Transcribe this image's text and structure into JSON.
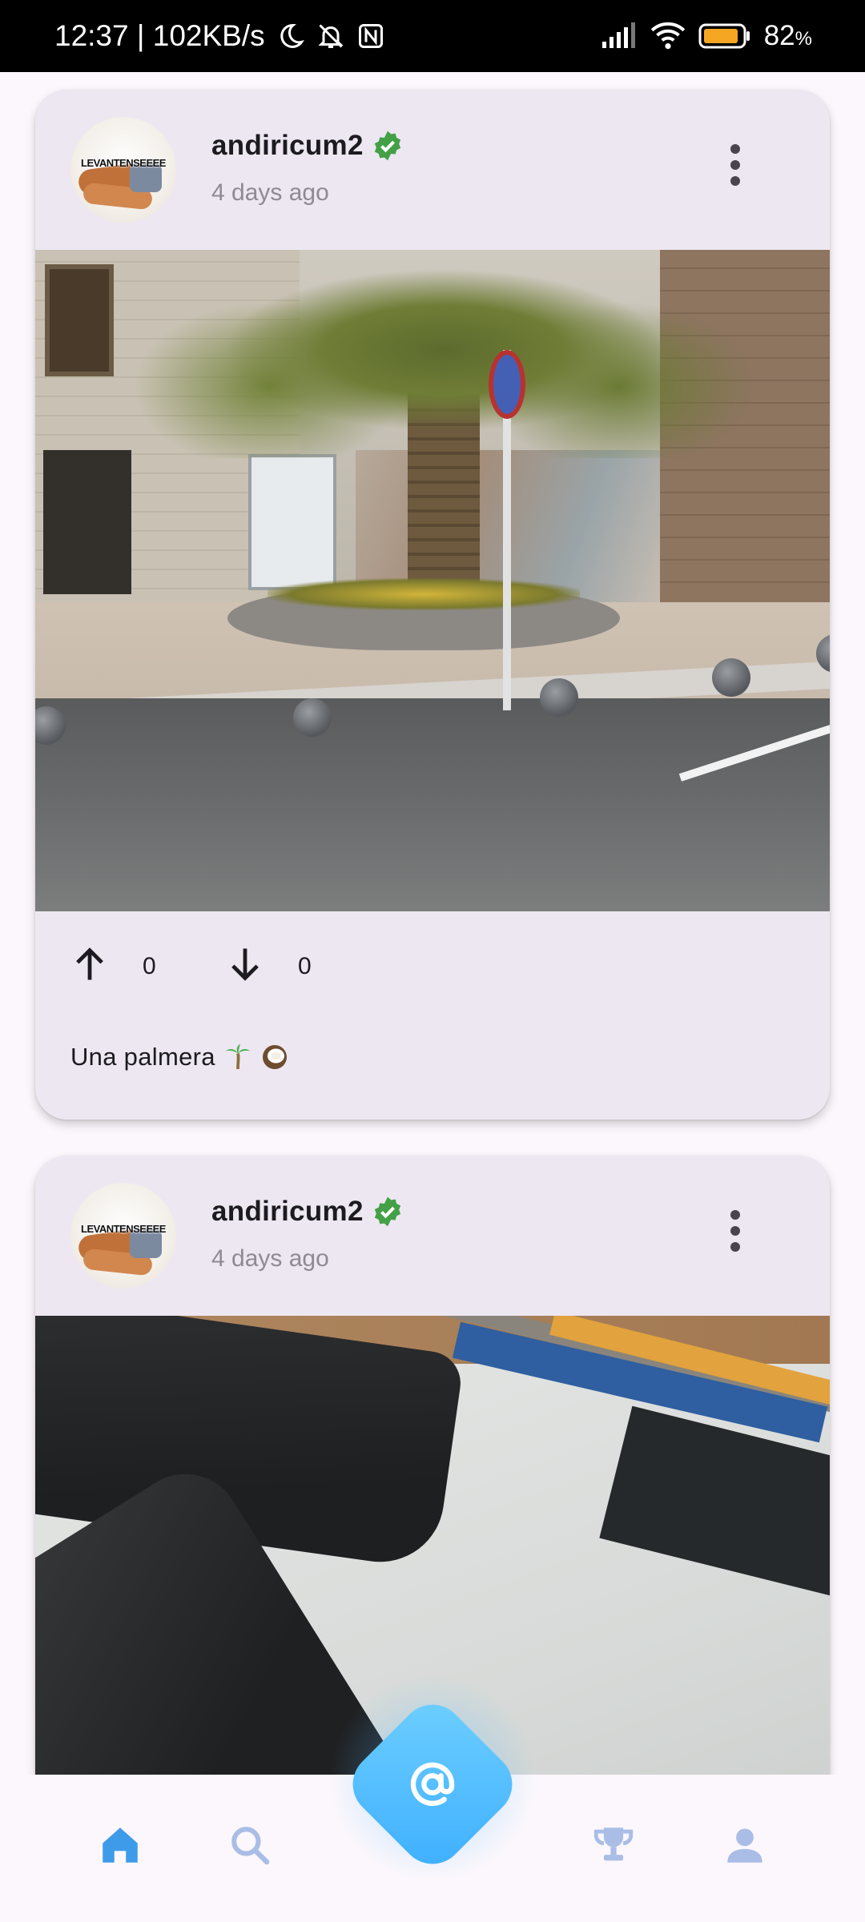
{
  "status_bar": {
    "time_speed": "12:37 | 102KB/s",
    "battery": "82",
    "battery_unit": "%"
  },
  "posts": [
    {
      "username": "andiricum2",
      "avatar_text": "LEVANTENSEEEE",
      "time": "4 days ago",
      "upvotes": "0",
      "downvotes": "0",
      "caption": "Una palmera"
    },
    {
      "username": "andiricum2",
      "avatar_text": "LEVANTENSEEEE",
      "time": "4 days ago"
    }
  ],
  "icons": {
    "status": [
      "moon-icon",
      "bell-off-icon",
      "nfc-icon",
      "signal-icon",
      "wifi-icon",
      "battery-icon"
    ],
    "nav": [
      "home-icon",
      "search-icon",
      "at-sign-icon",
      "trophy-icon",
      "profile-icon"
    ]
  },
  "colors": {
    "accent": "#3daeff",
    "nav_active": "#3d9be9",
    "nav_inactive": "#a9bde6",
    "verified": "#43a047",
    "card_bg": "#ede7f1"
  }
}
